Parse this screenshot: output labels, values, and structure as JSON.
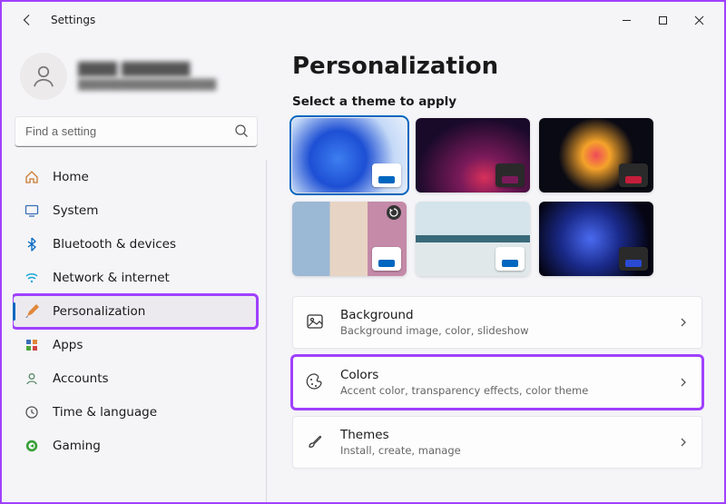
{
  "window": {
    "title": "Settings"
  },
  "user": {
    "name": "████ ███████",
    "email": "██████████████████"
  },
  "search": {
    "placeholder": "Find a setting"
  },
  "sidebar": {
    "items": [
      {
        "id": "home",
        "label": "Home"
      },
      {
        "id": "system",
        "label": "System"
      },
      {
        "id": "bluetooth",
        "label": "Bluetooth & devices"
      },
      {
        "id": "network",
        "label": "Network & internet"
      },
      {
        "id": "personalization",
        "label": "Personalization",
        "selected": true,
        "highlighted": true
      },
      {
        "id": "apps",
        "label": "Apps"
      },
      {
        "id": "accounts",
        "label": "Accounts"
      },
      {
        "id": "time",
        "label": "Time & language"
      },
      {
        "id": "gaming",
        "label": "Gaming"
      }
    ]
  },
  "page": {
    "title": "Personalization",
    "theme_label": "Select a theme to apply",
    "options": [
      {
        "id": "background",
        "title": "Background",
        "subtitle": "Background image, color, slideshow"
      },
      {
        "id": "colors",
        "title": "Colors",
        "subtitle": "Accent color, transparency effects, color theme",
        "highlighted": true
      },
      {
        "id": "themes",
        "title": "Themes",
        "subtitle": "Install, create, manage"
      }
    ]
  }
}
